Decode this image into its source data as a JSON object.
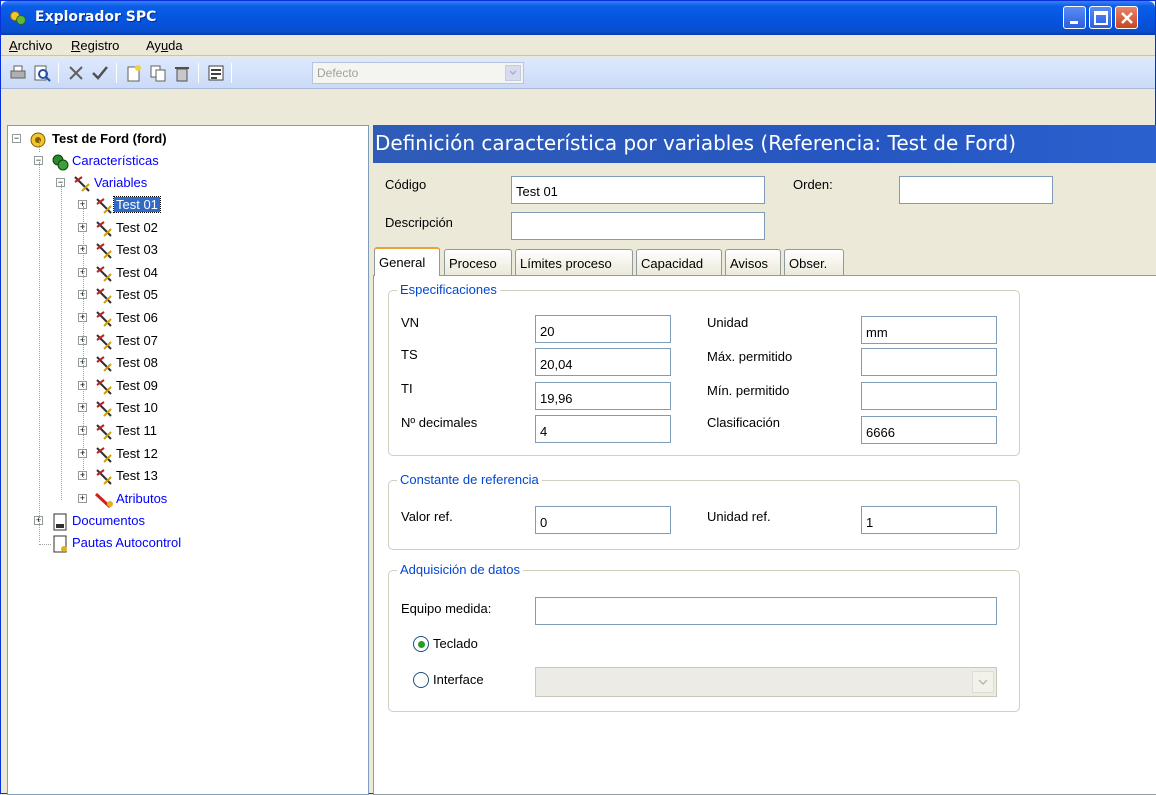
{
  "window": {
    "title": "Explorador SPC"
  },
  "menu": [
    {
      "label": "Archivo",
      "mnemonic": "A",
      "rest": "rchivo"
    },
    {
      "label": "Registro",
      "mnemonic": "R",
      "rest": "egistro"
    },
    {
      "label": "Ayuda",
      "pre": "Ay",
      "mnemonic": "u",
      "rest": "da"
    }
  ],
  "toolbar": {
    "icons": [
      "print-icon",
      "print-preview-icon",
      "delete-x-icon",
      "accept-check-icon",
      "new-document-icon",
      "copy-icon",
      "trash-icon",
      "form-view-icon"
    ],
    "combo_value": "Defecto"
  },
  "tree": {
    "root": "Test de Ford (ford)",
    "caracteristicas": "Características",
    "variables": "Variables",
    "items": [
      "Test 01",
      "Test 02",
      "Test 03",
      "Test 04",
      "Test 05",
      "Test 06",
      "Test 07",
      "Test 08",
      "Test 09",
      "Test 10",
      "Test 11",
      "Test 12",
      "Test 13"
    ],
    "selected": "Test 01",
    "atributos": "Atributos",
    "documentos": "Documentos",
    "pautas": "Pautas Autocontrol"
  },
  "header": {
    "title": "Definición característica por variables (Referencia: Test de Ford)"
  },
  "form": {
    "codigo_label": "Código",
    "codigo_value": "Test 01",
    "orden_label": "Orden:",
    "orden_value": "",
    "descripcion_label": "Descripción",
    "descripcion_value": ""
  },
  "tabs": [
    {
      "label": "General",
      "active": true
    },
    {
      "label": "Proceso"
    },
    {
      "label": "Límites proceso"
    },
    {
      "label": "Capacidad"
    },
    {
      "label": "Avisos"
    },
    {
      "label": "Obser."
    }
  ],
  "especificaciones": {
    "title": "Especificaciones",
    "vn_label": "VN",
    "vn_value": "20",
    "ts_label": "TS",
    "ts_value": "20,04",
    "ti_label": "TI",
    "ti_value": "19,96",
    "decimales_label": "Nº decimales",
    "decimales_value": "4",
    "unidad_label": "Unidad",
    "unidad_value": "mm",
    "max_label": "Máx. permitido",
    "max_value": "",
    "min_label": "Mín. permitido",
    "min_value": "",
    "clasificacion_label": "Clasificación",
    "clasificacion_value": "6666"
  },
  "constante": {
    "title": "Constante de referencia",
    "valor_label": "Valor ref.",
    "valor_value": "0",
    "unidad_label": "Unidad ref.",
    "unidad_value": "1"
  },
  "adquisicion": {
    "title": "Adquisición de datos",
    "equipo_label": "Equipo medida:",
    "equipo_value": "",
    "teclado_label": "Teclado",
    "interface_label": "Interface",
    "selected": "Teclado"
  },
  "colors": {
    "title_bar": "#0553df",
    "header_bar": "#2656c0",
    "group_title": "#0046d5",
    "link": "#0000ff",
    "selection": "#316ac5"
  }
}
